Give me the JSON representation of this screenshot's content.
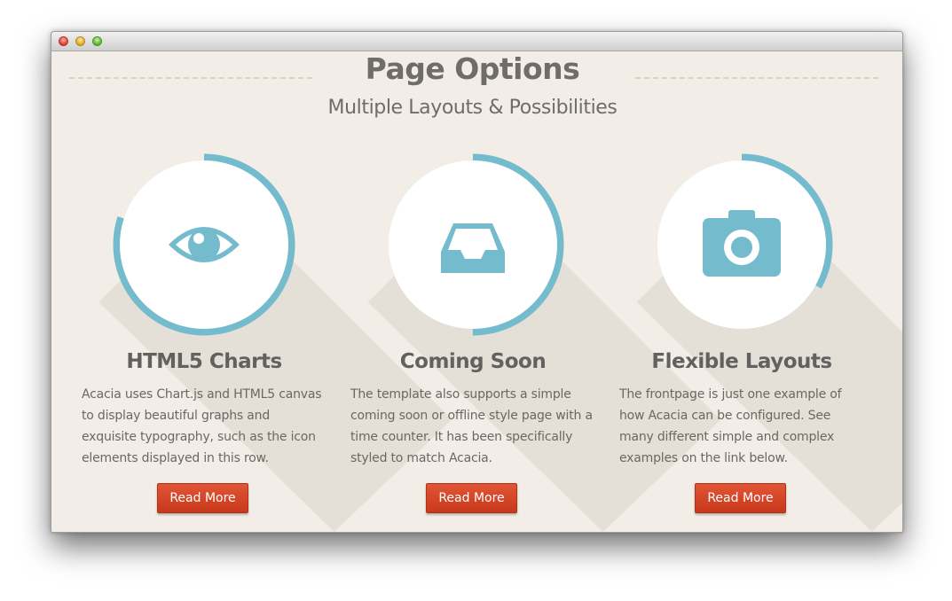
{
  "header": {
    "title": "Page Options",
    "subtitle": "Multiple Layouts & Possibilities"
  },
  "colors": {
    "accent": "#74bccd",
    "background": "#f2eee7",
    "button": "#d5462a",
    "heading": "#636160"
  },
  "features": [
    {
      "icon": "eye-icon",
      "title": "HTML5 Charts",
      "description": "Acacia uses Chart.js and HTML5 canvas to display beautiful graphs and exquisite typography, such as the icon elements displayed in this row.",
      "button_label": "Read More",
      "progress_percent": 80
    },
    {
      "icon": "inbox-icon",
      "title": "Coming Soon",
      "description": "The template also supports a simple coming soon or offline style page with a time counter. It has been specifically styled to match Acacia.",
      "button_label": "Read More",
      "progress_percent": 50
    },
    {
      "icon": "camera-icon",
      "title": "Flexible Layouts",
      "description": "The frontpage is just one example of how Acacia can be configured. See many different simple and complex examples on the link below.",
      "button_label": "Read More",
      "progress_percent": 33
    }
  ]
}
